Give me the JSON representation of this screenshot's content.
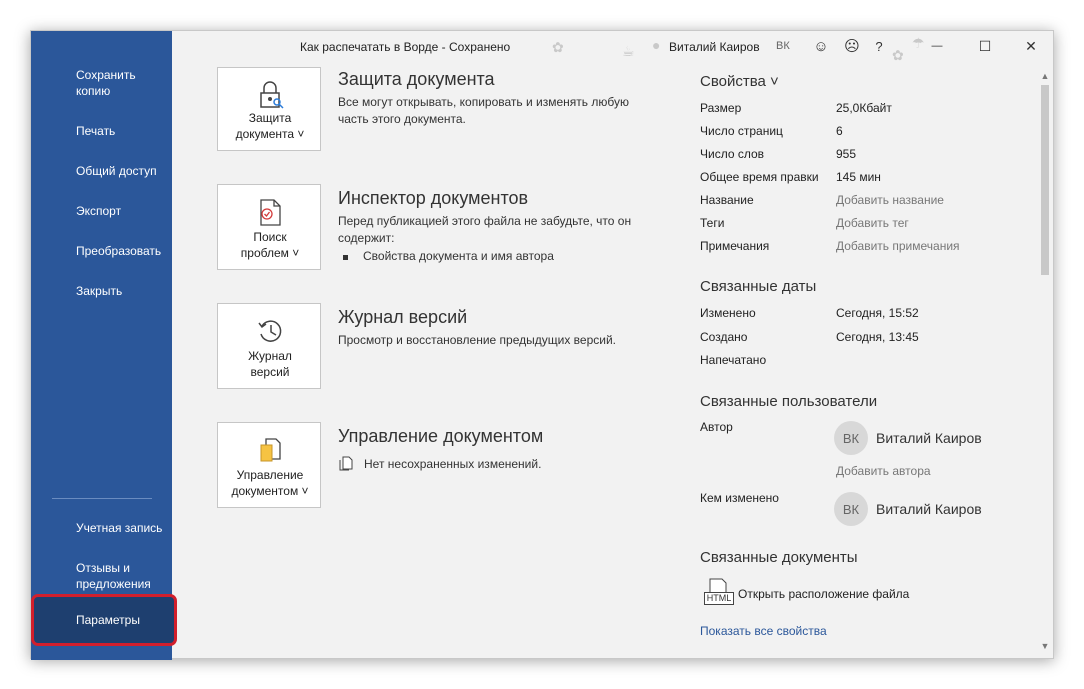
{
  "window": {
    "doc_title": "Как распечатать в Ворде  -  Сохранено",
    "user_name": "Виталий Каиров",
    "user_initials": "ВК",
    "help": "?",
    "minimize": "—",
    "maximize": "☐",
    "close": "✕"
  },
  "sidebar": {
    "items": [
      {
        "label": "Сохранить копию"
      },
      {
        "label": "Печать"
      },
      {
        "label": "Общий доступ"
      },
      {
        "label": "Экспорт"
      },
      {
        "label": "Преобразовать"
      },
      {
        "label": "Закрыть"
      }
    ],
    "account": "Учетная запись",
    "feedback": "Отзывы и предложения",
    "options": "Параметры"
  },
  "protect": {
    "button": "Защита документа ˅",
    "title": "Защита документа",
    "text": "Все могут открывать, копировать и изменять любую часть этого документа."
  },
  "inspect": {
    "button": "Поиск проблем ˅",
    "title": "Инспектор документов",
    "text": "Перед публикацией этого файла не забудьте, что он содержит:",
    "bullet": "Свойства документа и имя автора"
  },
  "versions": {
    "button": "Журнал версий",
    "title": "Журнал версий",
    "text": "Просмотр и восстановление предыдущих версий."
  },
  "manage": {
    "button": "Управление документом ˅",
    "title": "Управление документом",
    "text": "Нет несохраненных изменений."
  },
  "properties": {
    "title": "Свойства ˅",
    "rows": [
      {
        "label": "Размер",
        "value": "25,0Кбайт"
      },
      {
        "label": "Число страниц",
        "value": "6"
      },
      {
        "label": "Число слов",
        "value": "955"
      },
      {
        "label": "Общее время правки",
        "value": "145 мин"
      },
      {
        "label": "Название",
        "value": "Добавить название"
      },
      {
        "label": "Теги",
        "value": "Добавить тег"
      },
      {
        "label": "Примечания",
        "value": "Добавить примечания"
      }
    ]
  },
  "dates": {
    "title": "Связанные даты",
    "rows": [
      {
        "label": "Изменено",
        "value": "Сегодня, 15:52"
      },
      {
        "label": "Создано",
        "value": "Сегодня, 13:45"
      },
      {
        "label": "Напечатано",
        "value": ""
      }
    ]
  },
  "people": {
    "title": "Связанные пользователи",
    "author_label": "Автор",
    "author_initials": "ВК",
    "author_name": "Виталий Каиров",
    "add_author": "Добавить автора",
    "modified_label": "Кем изменено",
    "modified_initials": "ВК",
    "modified_name": "Виталий Каиров"
  },
  "docs": {
    "title": "Связанные документы",
    "file_type": "HTML",
    "open_location": "Открыть расположение файла",
    "show_all": "Показать все свойства"
  }
}
